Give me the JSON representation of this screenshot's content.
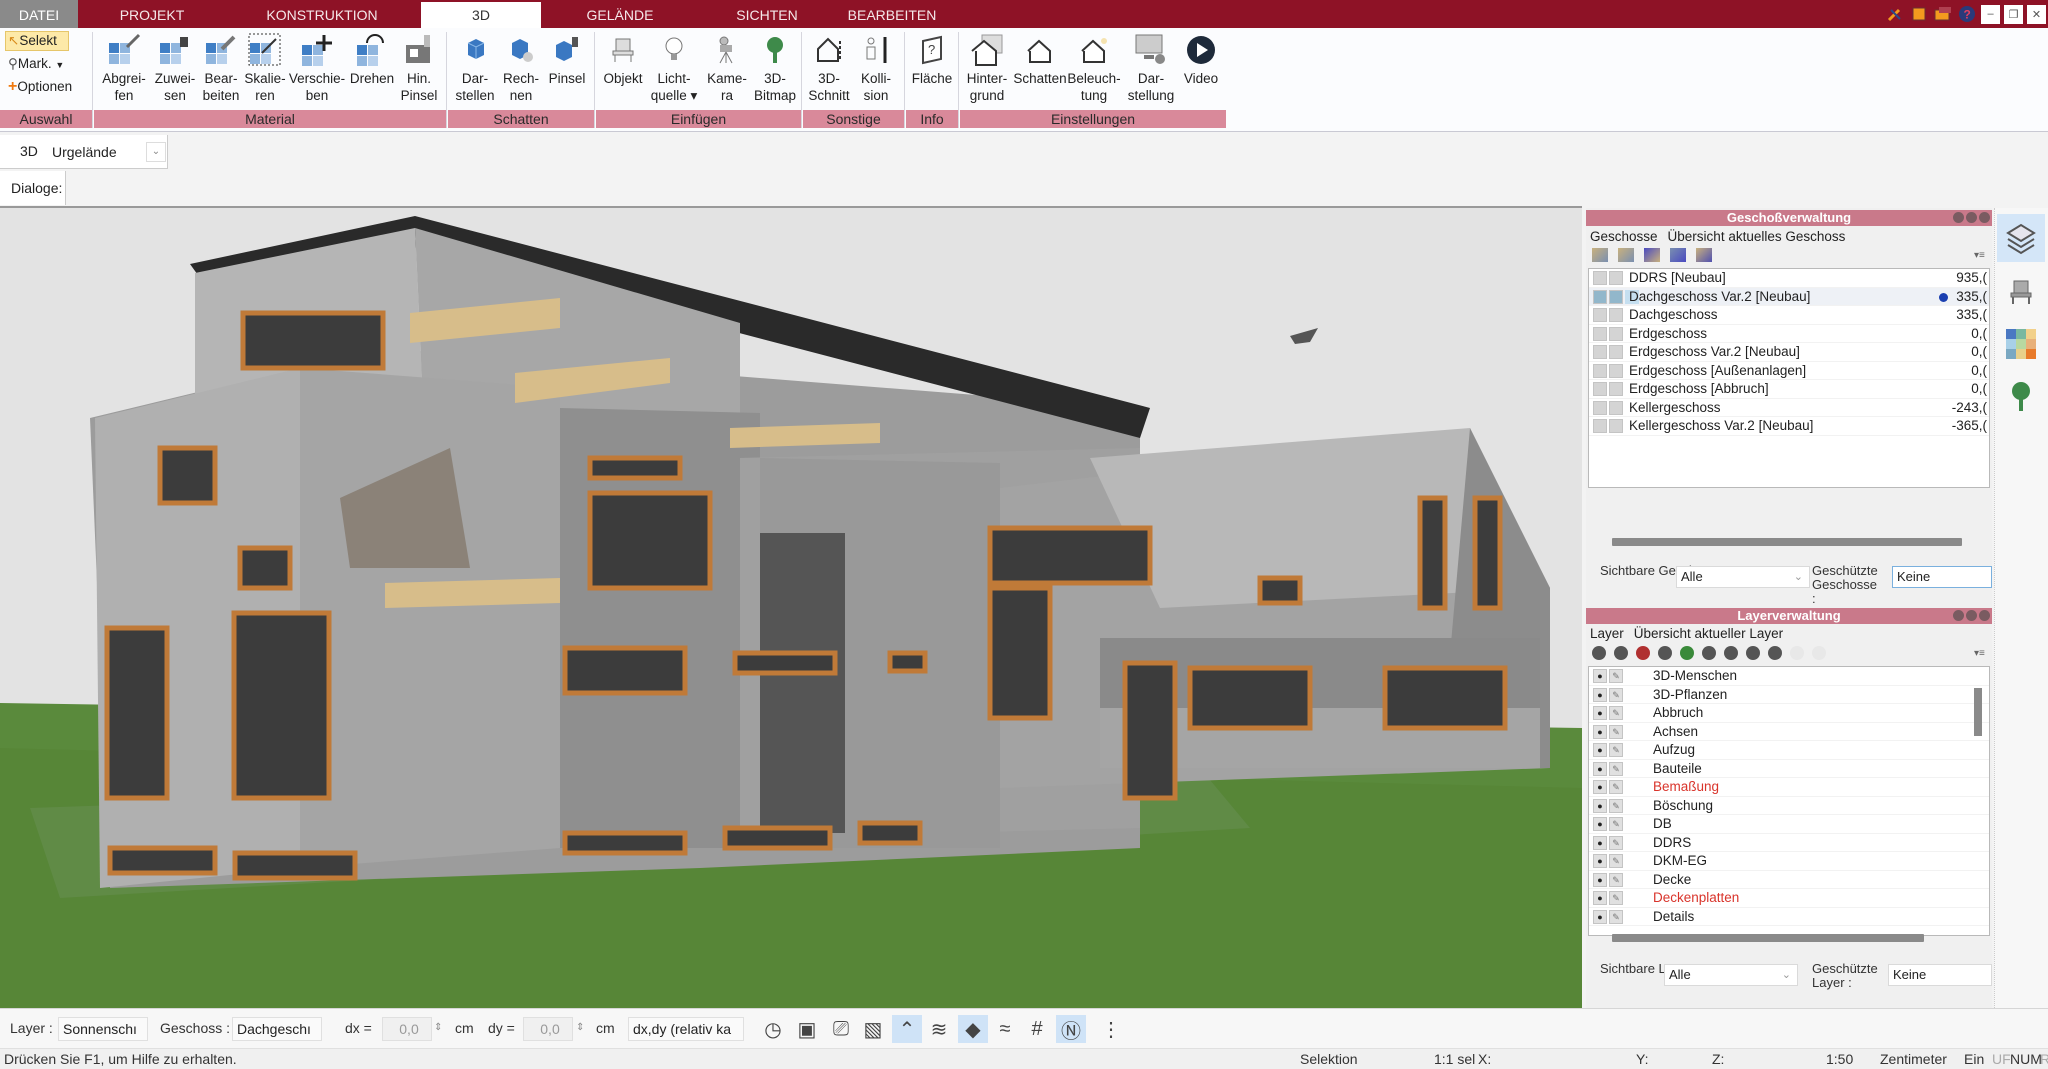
{
  "tabs": [
    {
      "label": "DATEI",
      "active": false
    },
    {
      "label": "PROJEKT",
      "active": false
    },
    {
      "label": "KONSTRUKTION",
      "active": false
    },
    {
      "label": "3D",
      "active": true
    },
    {
      "label": "GELÄNDE",
      "active": false
    },
    {
      "label": "SICHTEN",
      "active": false
    },
    {
      "label": "BEARBEITEN",
      "active": false
    }
  ],
  "window_icons": [
    "tools-icon",
    "window-icon",
    "window-switch-icon",
    "help-icon"
  ],
  "window_buttons": {
    "minimize": "–",
    "restore": "❐",
    "close": "✕"
  },
  "ribbon": {
    "auswahl": {
      "selekt": "Selekt",
      "mark": "Mark.",
      "optionen": "Optionen"
    },
    "material": [
      {
        "l1": "Abgrei-",
        "l2": "fen",
        "icon": "pick-material-icon"
      },
      {
        "l1": "Zuwei-",
        "l2": "sen",
        "icon": "assign-material-icon"
      },
      {
        "l1": "Bear-",
        "l2": "beiten",
        "icon": "edit-material-icon"
      },
      {
        "l1": "Skalie-",
        "l2": "ren",
        "icon": "scale-material-icon"
      },
      {
        "l1": "Verschie-",
        "l2": "ben",
        "icon": "move-material-icon"
      },
      {
        "l1": "Drehen",
        "l2": "",
        "icon": "rotate-material-icon"
      },
      {
        "l1": "Hin.",
        "l2": "Pinsel",
        "icon": "brush-icon"
      }
    ],
    "schatten": [
      {
        "l1": "Dar-",
        "l2": "stellen",
        "icon": "shadow-display-icon"
      },
      {
        "l1": "Rech-",
        "l2": "nen",
        "icon": "shadow-compute-icon"
      },
      {
        "l1": "Pinsel",
        "l2": "",
        "icon": "shadow-brush-icon"
      }
    ],
    "einfuegen": [
      {
        "l1": "Objekt",
        "l2": "",
        "icon": "chair-icon"
      },
      {
        "l1": "Licht-",
        "l2": "quelle ▾",
        "icon": "light-bulb-icon"
      },
      {
        "l1": "Kame-",
        "l2": "ra",
        "icon": "camera-icon"
      },
      {
        "l1": "3D-",
        "l2": "Bitmap",
        "icon": "tree-icon"
      }
    ],
    "sonstige": [
      {
        "l1": "3D-",
        "l2": "Schnitt",
        "icon": "section-icon"
      },
      {
        "l1": "Kolli-",
        "l2": "sion",
        "icon": "collision-icon"
      }
    ],
    "info": [
      {
        "l1": "Fläche",
        "l2": "",
        "icon": "area-info-icon"
      }
    ],
    "einstellungen": [
      {
        "l1": "Hinter-",
        "l2": "grund",
        "icon": "background-icon"
      },
      {
        "l1": "Schatten",
        "l2": "",
        "icon": "shadow-settings-icon"
      },
      {
        "l1": "Beleuch-",
        "l2": "tung",
        "icon": "lighting-icon"
      },
      {
        "l1": "Dar-",
        "l2": "stellung",
        "icon": "display-settings-icon"
      },
      {
        "l1": "Video",
        "l2": "",
        "icon": "video-play-icon"
      }
    ],
    "groups": {
      "auswahl": "Auswahl",
      "material": "Material",
      "schatten": "Schatten",
      "einfuegen": "Einfügen",
      "sonstige": "Sonstige",
      "info": "Info",
      "einstellungen": "Einstellungen"
    }
  },
  "view_bar": {
    "label": "3D",
    "terrain": "Urgelände"
  },
  "dialog_bar": {
    "label": "Dialoge:"
  },
  "geschoss_panel": {
    "title": "Geschoßverwaltung",
    "tab1": "Geschosse",
    "tab2": "Übersicht aktuelles Geschoss",
    "rows": [
      {
        "name": "DDRS [Neubau]",
        "value": "935,(",
        "selected": false
      },
      {
        "name": "Dachgeschoss Var.2 [Neubau]",
        "value": "335,(",
        "selected": true
      },
      {
        "name": "Dachgeschoss",
        "value": "335,(",
        "selected": false
      },
      {
        "name": "Erdgeschoss",
        "value": "0,(",
        "selected": false
      },
      {
        "name": "Erdgeschoss Var.2 [Neubau]",
        "value": "0,(",
        "selected": false
      },
      {
        "name": "Erdgeschoss [Außenanlagen]",
        "value": "0,(",
        "selected": false
      },
      {
        "name": "Erdgeschoss [Abbruch]",
        "value": "0,(",
        "selected": false
      },
      {
        "name": "Kellergeschoss",
        "value": "-243,(",
        "selected": false
      },
      {
        "name": "Kellergeschoss Var.2 [Neubau]",
        "value": "-365,(",
        "selected": false
      }
    ],
    "visible_label": "Sichtbare Geschosse :",
    "visible_value": "Alle",
    "protected_label": "Geschützte Geschosse :",
    "protected_value": "Keine"
  },
  "layer_panel": {
    "title": "Layerverwaltung",
    "tab1": "Layer",
    "tab2": "Übersicht aktueller Layer",
    "rows": [
      {
        "name": "3D-Menschen",
        "highlight": false
      },
      {
        "name": "3D-Pflanzen",
        "highlight": false
      },
      {
        "name": "Abbruch",
        "highlight": false
      },
      {
        "name": "Achsen",
        "highlight": false
      },
      {
        "name": "Aufzug",
        "highlight": false
      },
      {
        "name": "Bauteile",
        "highlight": false
      },
      {
        "name": "Bemaßung",
        "highlight": true
      },
      {
        "name": "Böschung",
        "highlight": false
      },
      {
        "name": "DB",
        "highlight": false
      },
      {
        "name": "DDRS",
        "highlight": false
      },
      {
        "name": "DKM-EG",
        "highlight": false
      },
      {
        "name": "Decke",
        "highlight": false
      },
      {
        "name": "Deckenplatten",
        "highlight": true
      },
      {
        "name": "Details",
        "highlight": false
      }
    ],
    "visible_label": "Sichtbare Layer :",
    "visible_value": "Alle",
    "protected_label": "Geschützte Layer :",
    "protected_value": "Keine"
  },
  "side_icons": [
    "layers-icon",
    "chair-icon",
    "color-palette-icon",
    "tree-icon"
  ],
  "bottom_toolbar": {
    "layer_label": "Layer :",
    "layer_value": "Sonnenschı",
    "geschoss_label": "Geschoss :",
    "geschoss_value": "Dachgeschı",
    "dx_label": "dx =",
    "dx_value": "0,0",
    "dx_unit": "cm",
    "dy_label": "dy =",
    "dy_value": "0,0",
    "dy_unit": "cm",
    "mode_value": "dx,dy (relativ ka",
    "tools": [
      {
        "icon": "clock-icon",
        "on": false
      },
      {
        "icon": "presentation-icon",
        "on": false
      },
      {
        "icon": "video-camera-icon",
        "on": false
      },
      {
        "icon": "layers-color-icon",
        "on": false
      },
      {
        "icon": "roof-icon",
        "on": true
      },
      {
        "icon": "beams-icon",
        "on": false
      },
      {
        "icon": "slab-icon",
        "on": true
      },
      {
        "icon": "terrain-icon",
        "on": false
      },
      {
        "icon": "grid-icon",
        "on": false
      },
      {
        "icon": "north-icon",
        "on": true
      },
      {
        "icon": "more-icon",
        "on": false
      }
    ]
  },
  "status": {
    "help": "Drücken Sie F1, um Hilfe zu erhalten.",
    "mode": "Selektion",
    "sel": "1:1 sel",
    "x": "X:",
    "y": "Y:",
    "z": "Z:",
    "scale": "1:50",
    "unit": "Zentimeter",
    "ein": "Ein",
    "uf": "UF",
    "num": "NUM",
    "rf": "RI"
  },
  "colors": {
    "accent": "#8e1226",
    "group_bar": "#d9899a",
    "panel_title": "#c9798a",
    "layer_highlight": "#d9342b",
    "wood": "#b8763a",
    "grass": "#5c8a3e"
  }
}
